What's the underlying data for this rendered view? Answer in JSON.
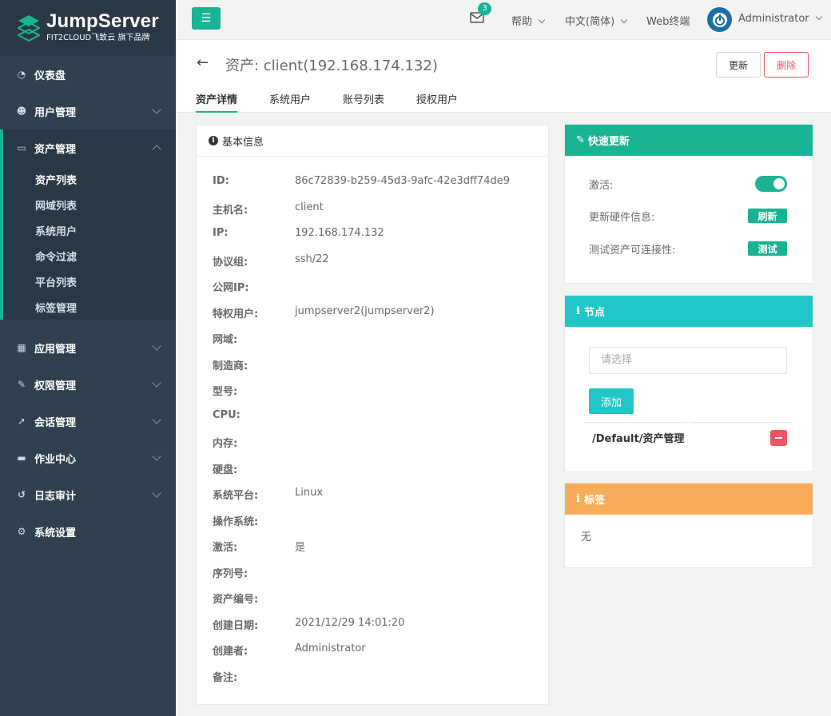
{
  "brand": {
    "name": "JumpServer",
    "tagline": "FIT2CLOUD飞致云 旗下品牌"
  },
  "sidebar": {
    "items": [
      {
        "label": "仪表盘",
        "icon": "dashboard-icon"
      },
      {
        "label": "用户管理",
        "icon": "users-icon"
      },
      {
        "label": "资产管理",
        "icon": "inbox-icon"
      },
      {
        "label": "应用管理",
        "icon": "grid-icon"
      },
      {
        "label": "权限管理",
        "icon": "edit-icon"
      },
      {
        "label": "会话管理",
        "icon": "rocket-icon"
      },
      {
        "label": "作业中心",
        "icon": "coffee-icon"
      },
      {
        "label": "日志审计",
        "icon": "history-icon"
      },
      {
        "label": "系统设置",
        "icon": "gears-icon"
      }
    ],
    "asset_sub": [
      "资产列表",
      "网域列表",
      "系统用户",
      "命令过滤",
      "平台列表",
      "标签管理"
    ]
  },
  "topbar": {
    "mail_count": "3",
    "help": "帮助",
    "language": "中文(简体)",
    "web_terminal": "Web终端",
    "user": "Administrator"
  },
  "page": {
    "title": "资产: client(192.168.174.132)",
    "update_label": "更新",
    "delete_label": "删除",
    "tabs": [
      "资产详情",
      "系统用户",
      "账号列表",
      "授权用户"
    ]
  },
  "basic_info": {
    "title": "基本信息",
    "rows": [
      {
        "k": "ID:",
        "v": "86c72839-b259-45d3-9afc-42e3dff74de9"
      },
      {
        "k": "主机名:",
        "v": "client"
      },
      {
        "k": "IP:",
        "v": "192.168.174.132"
      },
      {
        "k": "协议组:",
        "v": "ssh/22"
      },
      {
        "k": "公网IP:",
        "v": ""
      },
      {
        "k": "特权用户:",
        "v": "jumpserver2(jumpserver2)"
      },
      {
        "k": "网域:",
        "v": ""
      },
      {
        "k": "制造商:",
        "v": ""
      },
      {
        "k": "型号:",
        "v": ""
      },
      {
        "k": "CPU:",
        "v": ""
      },
      {
        "k": "内存:",
        "v": ""
      },
      {
        "k": "硬盘:",
        "v": ""
      },
      {
        "k": "系统平台:",
        "v": "Linux"
      },
      {
        "k": "操作系统:",
        "v": ""
      },
      {
        "k": "激活:",
        "v": "是"
      },
      {
        "k": "序列号:",
        "v": ""
      },
      {
        "k": "资产编号:",
        "v": ""
      },
      {
        "k": "创建日期:",
        "v": "2021/12/29 14:01:20"
      },
      {
        "k": "创建者:",
        "v": "Administrator"
      },
      {
        "k": "备注:",
        "v": ""
      }
    ]
  },
  "quick_update": {
    "title": "快速更新",
    "active_label": "激活:",
    "active_on": true,
    "hw_label": "更新硬件信息:",
    "hw_btn": "刷新",
    "test_label": "测试资产可连接性:",
    "test_btn": "测试"
  },
  "nodes": {
    "title": "节点",
    "placeholder": "请选择",
    "add_btn": "添加",
    "items": [
      "/Default/资产管理"
    ]
  },
  "labels": {
    "title": "标签",
    "value": "无"
  },
  "colors": {
    "accent": "#1ab394",
    "info": "#23c6c8",
    "warning": "#f8ac59",
    "danger": "#ed5565",
    "sidebar": "#2f4050"
  }
}
